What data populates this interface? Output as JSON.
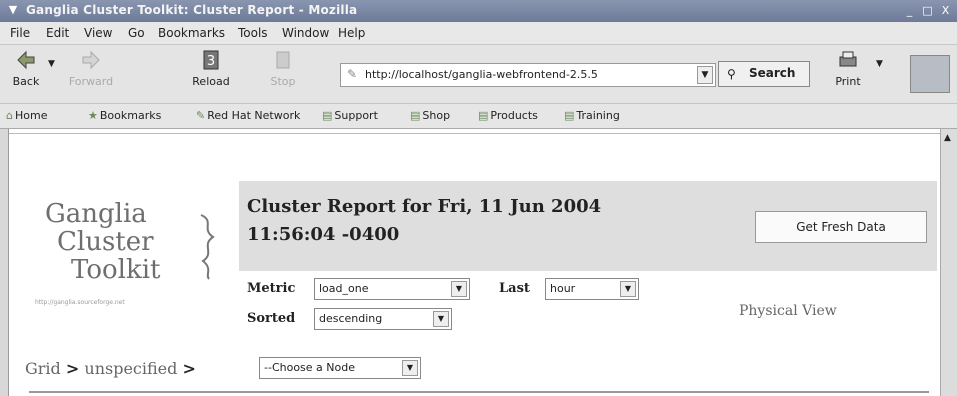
{
  "window": {
    "title": "Ganglia Cluster Toolkit: Cluster Report - Mozilla",
    "menu_icon": "chevron-down-icon",
    "controls": [
      "_",
      "□",
      "X"
    ]
  },
  "menubar": {
    "items": [
      "File",
      "Edit",
      "View",
      "Go",
      "Bookmarks",
      "Tools",
      "Window",
      "Help"
    ]
  },
  "toolbar": {
    "back_label": "Back",
    "forward_label": "Forward",
    "reload_label": "Reload",
    "stop_label": "Stop",
    "url": "http://localhost/ganglia-webfrontend-2.5.5",
    "search_label": "Search",
    "print_label": "Print"
  },
  "bookmarks": {
    "items": [
      "Home",
      "Bookmarks",
      "Red Hat Network",
      "Support",
      "Shop",
      "Products",
      "Training"
    ]
  },
  "logo": {
    "line1": "Ganglia",
    "line2": "Cluster",
    "line3": "Toolkit",
    "url": "http://ganglia.sourceforge.net"
  },
  "report": {
    "title": "Cluster Report for Fri, 11 Jun 2004 11:56:04 -0400",
    "fresh_button": "Get Fresh Data",
    "metric_label": "Metric",
    "metric_value": "load_one",
    "last_label": "Last",
    "last_value": "hour",
    "sorted_label": "Sorted",
    "sorted_value": "descending",
    "physical_view": "Physical View"
  },
  "breadcrumb": {
    "grid": "Grid",
    "sep1": ">",
    "cluster": "unspecified",
    "sep2": ">",
    "node_select": "--Choose a Node"
  }
}
